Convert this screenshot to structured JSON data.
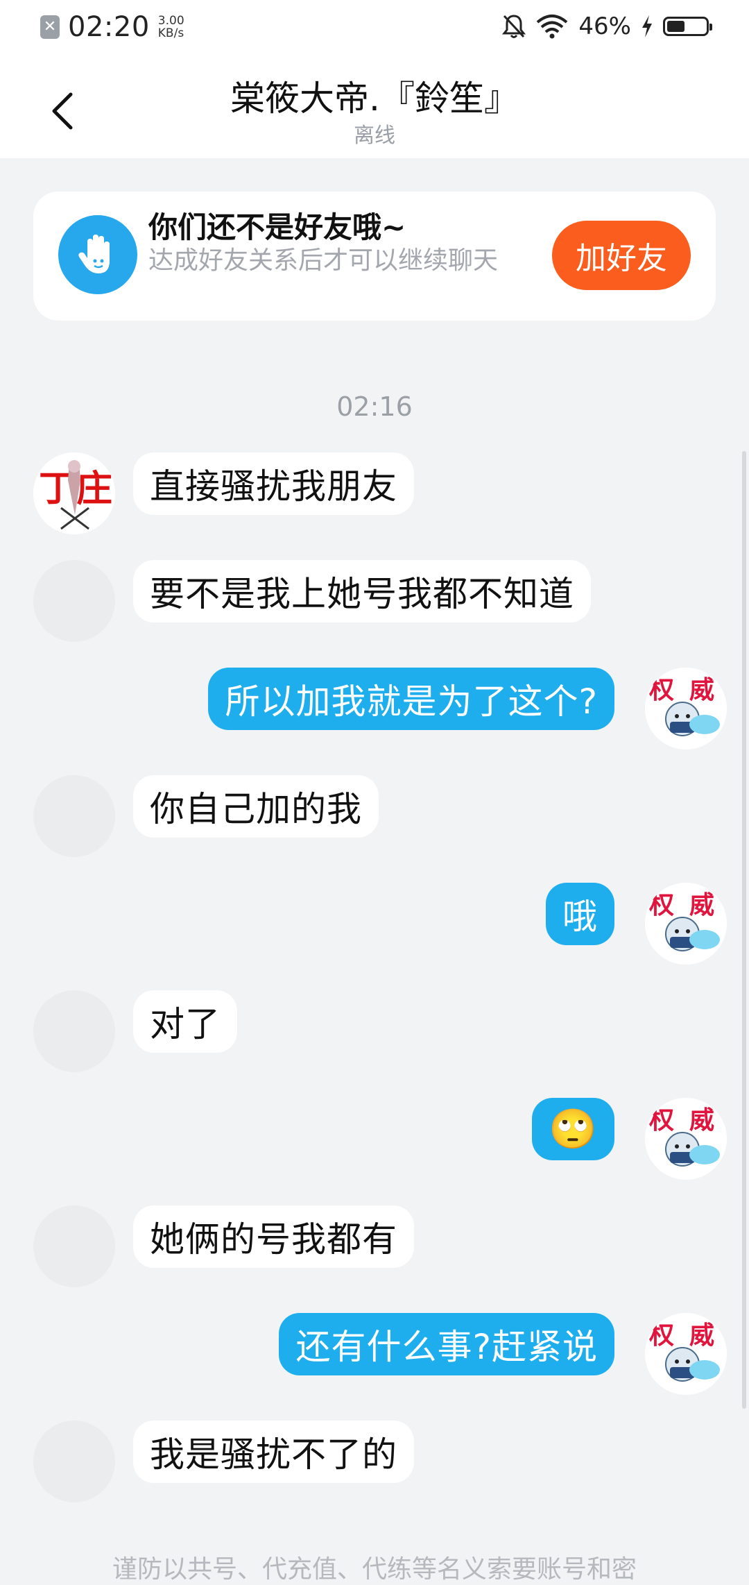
{
  "status_bar": {
    "time": "02:20",
    "speed_value": "3.00",
    "speed_unit": "KB/s",
    "battery_percent": "46%",
    "battery_level": 0.46
  },
  "header": {
    "title": "棠筱大帝.『鈴笙』",
    "subtitle": "离线"
  },
  "banner": {
    "title": "你们还不是好友哦~",
    "subtitle": "达成好友关系后才可以继续聊天",
    "button_label": "加好友"
  },
  "conversation": {
    "timestamp": "02:16",
    "messages": [
      {
        "from": "them",
        "text": "直接骚扰我朋友"
      },
      {
        "from": "them",
        "text": "要不是我上她号我都不知道"
      },
      {
        "from": "me",
        "text": "所以加我就是为了这个?"
      },
      {
        "from": "them",
        "text": "你自己加的我"
      },
      {
        "from": "me",
        "text": "哦"
      },
      {
        "from": "them",
        "text": "对了"
      },
      {
        "from": "me",
        "text": "🙄"
      },
      {
        "from": "them",
        "text": "她俩的号我都有"
      },
      {
        "from": "me",
        "text": "还有什么事?赶紧说"
      },
      {
        "from": "them",
        "text": "我是骚扰不了的"
      }
    ]
  },
  "footer": {
    "notice": "谨防以共号、代充值、代练等名义索要账号和密"
  },
  "colors": {
    "outgoing_bubble": "#1faeed",
    "add_friend_button": "#fa5d1e",
    "background": "#f2f3f5"
  }
}
